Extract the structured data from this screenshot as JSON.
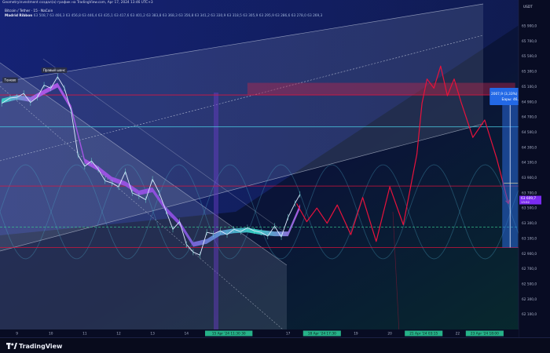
{
  "header": {
    "caption": "Geometryinvestment создал(а) график на TradingView.com, Apr 17, 2024 13:46 UTC+3"
  },
  "symbol_line": "Bitcoin / Tether · 15 · NaCoin",
  "indicator": {
    "name": "Madrid Ribbon",
    "values": "63 508,7  63 466,3  63 456,8  63 446,4  63 435,1  63 417,6  63 401,2  63 383,8  63 368,3  63 356,8  63 341,2  63 330,9  63 318,5  63 305,9  63 295,9  63 286,6  63 278,0  63 269,3"
  },
  "branding": {
    "name": "TradingView",
    "logo_icon": "tradingview-logo-icon"
  },
  "colors": {
    "background": "#0a0f2c",
    "channel_fill": "#b9c3d6",
    "ribbon_purple": "#b058e8",
    "ribbon_teal": "#33d3c5",
    "price_line": "#dfe9ff",
    "projection": "#e8123c",
    "cyan_level": "#49c9e0",
    "callout_bg": "#2369e6",
    "price_badge": "#7a2bf0"
  },
  "chart_data": {
    "type": "line",
    "ylim": [
      61900,
      66200
    ],
    "xlim": [
      8.5,
      23.8
    ],
    "unit": "USDT",
    "y_ticks": [
      "65 900,0",
      "65 700,0",
      "65 500,0",
      "65 300,0",
      "65 100,0",
      "64 900,0",
      "64 700,0",
      "64 500,0",
      "64 300,0",
      "64 100,0",
      "63 900,0",
      "63 700,0",
      "63 500,0",
      "63 300,0",
      "63 100,0",
      "62 900,0",
      "62 700,0",
      "62 500,0",
      "62 300,0",
      "62 100,0"
    ],
    "x_ticks": [
      {
        "x": 9,
        "label": "9"
      },
      {
        "x": 10,
        "label": "10"
      },
      {
        "x": 11,
        "label": "11"
      },
      {
        "x": 12,
        "label": "12"
      },
      {
        "x": 13,
        "label": "13"
      },
      {
        "x": 14,
        "label": "14"
      },
      {
        "x": 15.25,
        "label": "15 Apr '24   11:30   30",
        "highlight": true
      },
      {
        "x": 17,
        "label": "17"
      },
      {
        "x": 18,
        "label": "18 Apr '24   17:30",
        "highlight": true
      },
      {
        "x": 19,
        "label": "19"
      },
      {
        "x": 20,
        "label": "20"
      },
      {
        "x": 21,
        "label": "21 Apr '24   03:15",
        "highlight": true
      },
      {
        "x": 22,
        "label": "22"
      },
      {
        "x": 22.8,
        "label": "23 Apr '24   18:00",
        "highlight": true
      }
    ],
    "series": [
      {
        "kind": "price",
        "x": [
          8.55,
          8.8,
          9.0,
          9.2,
          9.4,
          9.6,
          9.8,
          10.0,
          10.2,
          10.4,
          10.6,
          10.8,
          11.0,
          11.2,
          11.4,
          11.6,
          11.8,
          12.0,
          12.2,
          12.4,
          12.6,
          12.8,
          13.0,
          13.2,
          13.4,
          13.6,
          13.8,
          14.0,
          14.2,
          14.4,
          14.6,
          14.8,
          15.0,
          15.2,
          15.4,
          15.6,
          15.8,
          16.0,
          16.2,
          16.4,
          16.6,
          16.8,
          17.0,
          17.2,
          17.35
        ],
        "y": [
          64880,
          64950,
          64960,
          65010,
          64890,
          64960,
          65120,
          65080,
          65230,
          65080,
          64780,
          64200,
          64050,
          64120,
          64010,
          63860,
          63830,
          63780,
          63980,
          63700,
          63660,
          63610,
          63880,
          63700,
          63460,
          63220,
          63320,
          63020,
          62920,
          62880,
          63180,
          63160,
          63200,
          63150,
          63220,
          63190,
          63240,
          63200,
          63180,
          63130,
          63260,
          63120,
          63380,
          63560,
          63680
        ]
      },
      {
        "kind": "ribbon",
        "x": [
          8.55,
          9.0,
          9.4,
          9.8,
          10.2,
          10.6,
          11.0,
          11.4,
          11.8,
          12.2,
          12.6,
          13.0,
          13.4,
          13.8,
          14.2,
          14.6,
          15.0,
          15.4,
          15.8,
          16.2,
          16.6,
          17.0,
          17.35
        ],
        "y": [
          64910,
          64960,
          64930,
          65030,
          65120,
          64820,
          64120,
          64020,
          63880,
          63820,
          63700,
          63740,
          63480,
          63300,
          63020,
          63060,
          63170,
          63200,
          63210,
          63180,
          63160,
          63160,
          63520
        ]
      },
      {
        "kind": "projection",
        "x": [
          17.25,
          17.55,
          17.85,
          18.15,
          18.45,
          18.85,
          19.2,
          19.6,
          20.0,
          20.4,
          20.8,
          20.95,
          21.1,
          21.3,
          21.5,
          21.7,
          21.9,
          22.1,
          22.45,
          22.8,
          23.15,
          23.5
        ],
        "y": [
          63560,
          63320,
          63500,
          63300,
          63540,
          63150,
          63640,
          63060,
          63780,
          63280,
          64210,
          64880,
          65200,
          65080,
          65370,
          64980,
          65200,
          64900,
          64430,
          64660,
          64160,
          63560
        ]
      }
    ],
    "levels": [
      {
        "y": 64570,
        "style": "solid",
        "color": "#49c9e0"
      },
      {
        "y": 64990,
        "style": "solid",
        "color": "#e8123c"
      },
      {
        "y": 63790,
        "style": "solid",
        "color": "#e8123c"
      },
      {
        "y": 62980,
        "style": "solid",
        "color": "#e8123c"
      },
      {
        "y": 63250,
        "style": "dashed",
        "color": "#39c98f"
      }
    ],
    "resistance_zone": {
      "x": [
        15.8,
        23.7
      ],
      "y": [
        64990,
        65150
      ]
    },
    "callout": {
      "line1": "2007,9 (3,33%) 20879",
      "line2": "Бары: 46,",
      "target_y": 64980,
      "base_y": 62980,
      "price_x": 23.55
    },
    "annotations": [
      {
        "text": "Тенево",
        "x": 8.8,
        "y": 65160
      },
      {
        "text": "Правый шанс",
        "x": 10.1,
        "y": 65290
      }
    ],
    "current_price": {
      "label": "63 609,7",
      "sub": "13:52",
      "y": 63610
    }
  }
}
